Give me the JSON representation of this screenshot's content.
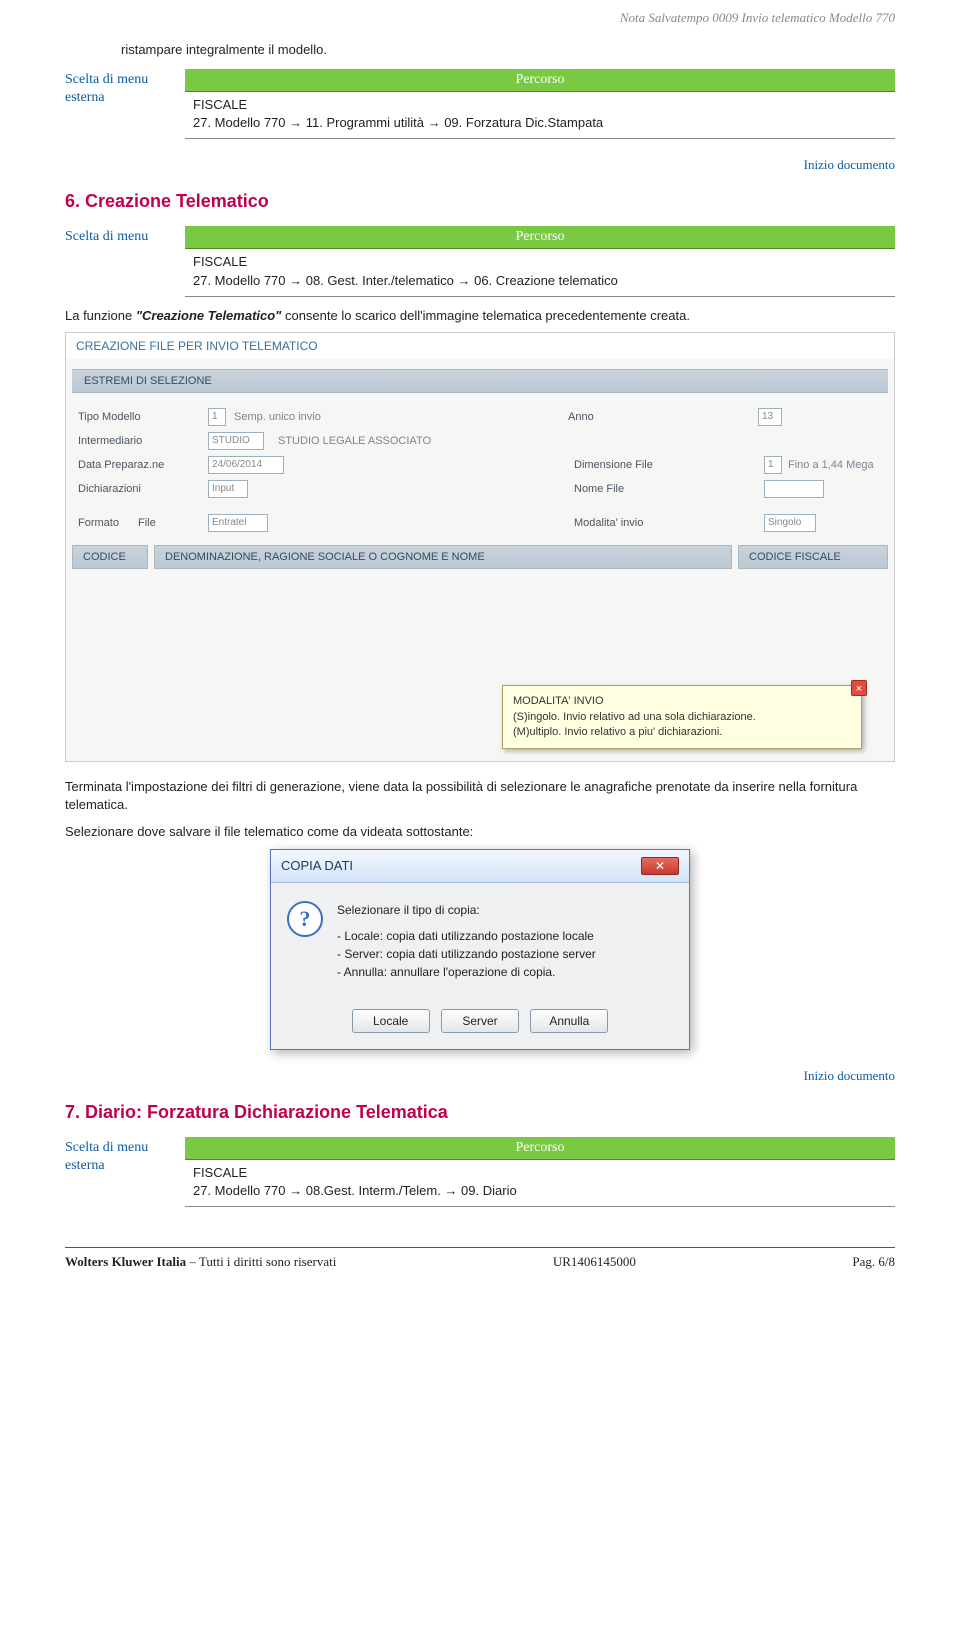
{
  "header": {
    "doc_title": "Nota Salvatempo 0009 Invio telematico Modello 770"
  },
  "intro": "ristampare integralmente il modello.",
  "menu_label_1": "Scelta di menu",
  "menu_label_2": "esterna",
  "percorso_label": "Percorso",
  "path1": {
    "line1": "FISCALE",
    "line2": "27. Modello 770 → 11. Programmi utilità → 09. Forzatura Dic.Stampata"
  },
  "inizio_link": "Inizio documento",
  "sec6_title": "6. Creazione Telematico",
  "path2": {
    "line1": "FISCALE",
    "line2": "27. Modello 770 → 08. Gest. Inter./telematico → 06. Creazione telematico"
  },
  "desc6_1": "La funzione ",
  "desc6_2": "\"Creazione Telematico\"",
  "desc6_3": " consente lo scarico dell'immagine telematica precedentemente creata.",
  "ss1": {
    "title": "CREAZIONE FILE PER INVIO TELEMATICO",
    "sub": "ESTREMI DI SELEZIONE",
    "tipo_modello_lbl": "Tipo Modello",
    "tipo_modello_val": "1",
    "tipo_modello_txt": "Semp. unico invio",
    "anno_lbl": "Anno",
    "anno_val": "13",
    "intermediario_lbl": "Intermediario",
    "intermediario_val": "STUDIO",
    "intermediario_txt": "STUDIO LEGALE ASSOCIATO",
    "data_lbl": "Data Preparaz.ne",
    "data_val": "24/06/2014",
    "dimfile_lbl": "Dimensione File",
    "dimfile_val": "1",
    "dimfile_txt": "Fino a 1,44 Mega",
    "dich_lbl": "Dichiarazioni",
    "dich_val": "Input",
    "nomefile_lbl": "Nome File",
    "formato_lbl": "Formato",
    "file_lbl": "File",
    "formato_val": "Entratel",
    "modalita_lbl": "Modalita' invio",
    "modalita_val": "Singolo",
    "col_codice": "CODICE",
    "col_denom": "DENOMINAZIONE, RAGIONE SOCIALE O COGNOME E NOME",
    "col_cf": "CODICE FISCALE",
    "tip_title": "MODALITA' INVIO",
    "tip_l1": "(S)ingolo. Invio relativo ad una sola dichiarazione.",
    "tip_l2": "(M)ultiplo. Invio relativo a piu' dichiarazioni."
  },
  "post_text1": "Terminata l'impostazione dei filtri di generazione, viene data la possibilità di selezionare le anagrafiche prenotate da inserire nella fornitura telematica.",
  "post_text2": "Selezionare dove salvare il file telematico come da videata sottostante:",
  "dialog": {
    "title": "COPIA DATI",
    "line1": "Selezionare il tipo di copia:",
    "opt1": "- Locale: copia dati utilizzando postazione locale",
    "opt2": "- Server: copia dati utilizzando postazione server",
    "opt3": "- Annulla: annullare l'operazione di copia.",
    "btn_locale": "Locale",
    "btn_server": "Server",
    "btn_annulla": "Annulla"
  },
  "sec7_title": "7. Diario: Forzatura Dichiarazione Telematica",
  "path3": {
    "line1": "FISCALE",
    "line2": "27. Modello 770 → 08.Gest. Interm./Telem. → 09. Diario"
  },
  "footer": {
    "company": "Wolters Kluwer Italia",
    "rights": " – Tutti i diritti sono riservati",
    "code": "UR1406145000",
    "page": "Pag. 6/8"
  }
}
